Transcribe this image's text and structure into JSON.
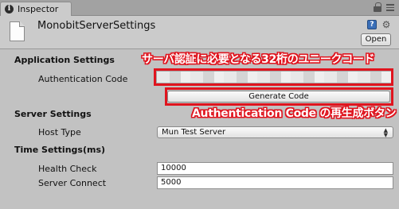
{
  "tab": {
    "label": "Inspector"
  },
  "header": {
    "title": "MonobitServerSettings",
    "open_label": "Open"
  },
  "sections": {
    "application": "Application Settings",
    "server": "Server Settings",
    "time": "Time Settings(ms)"
  },
  "fields": {
    "auth_code_label": "Authentication Code",
    "generate_label": "Generate Code",
    "host_type_label": "Host Type",
    "host_type_value": "Mun Test Server",
    "health_check_label": "Health Check",
    "health_check_value": "10000",
    "server_connect_label": "Server Connect",
    "server_connect_value": "5000"
  },
  "annotations": {
    "auth_code_note": "サーバ認証に必要となる32桁のユニークコード",
    "generate_note": "Authentication Code の再生成ボタン"
  },
  "colors": {
    "annotation_red": "#e0141e",
    "panel_bg": "#c2c2c2"
  }
}
